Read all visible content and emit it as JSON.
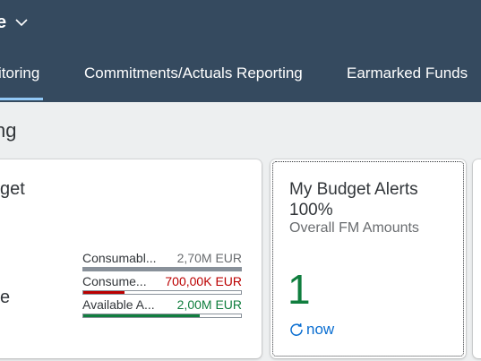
{
  "shell": {
    "title_fragment": "e"
  },
  "tabs": [
    {
      "label": "itoring",
      "selected": true
    },
    {
      "label": "Commitments/Actuals Reporting",
      "selected": false
    },
    {
      "label": "Earmarked Funds",
      "selected": false
    }
  ],
  "section": {
    "title_fragment": "ng"
  },
  "card_budget": {
    "title_fragment": "get",
    "kpi_fragment": "e",
    "bars": [
      {
        "label": "Consumabl...",
        "value": "2,70M EUR",
        "fill": 1.0,
        "color": "#89919a",
        "value_color": "#6a6d70"
      },
      {
        "label": "Consume...",
        "value": "700,00K EUR",
        "fill": 0.26,
        "color": "#bb0000",
        "value_color": "#bb0000"
      },
      {
        "label": "Available A...",
        "value": "2,00M EUR",
        "fill": 0.74,
        "color": "#107e3e",
        "value_color": "#107e3e"
      }
    ]
  },
  "card_alerts": {
    "title": "My Budget Alerts",
    "title_line2": "100%",
    "subtitle": "Overall FM Amounts",
    "kpi_value": "1",
    "refresh_label": "now",
    "refresh_icon": "refresh-icon",
    "kpi_color": "#107e3e",
    "refresh_color": "#0a6ed1"
  },
  "colors": {
    "shell_bg": "#354a5f",
    "page_bg": "#edeff0",
    "tab_indicator": "#91c8f6"
  }
}
